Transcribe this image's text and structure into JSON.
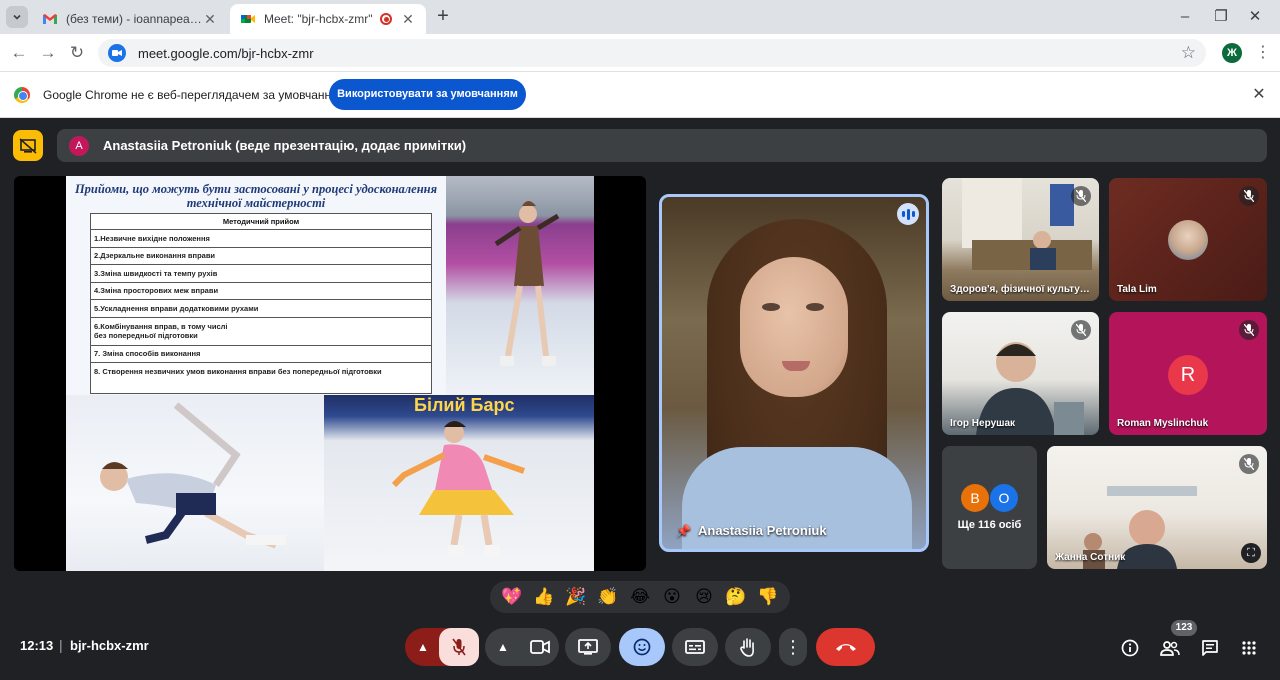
{
  "tabs": [
    {
      "title": "(без теми) - ioannapeace@gmail.com",
      "favicon": "gmail-icon",
      "active": false
    },
    {
      "title": "Meet: \"bjr-hcbx-zmr\"",
      "favicon": "meet-icon",
      "active": true,
      "recording": true
    }
  ],
  "address_bar": {
    "url": "meet.google.com/bjr-hcbx-zmr",
    "profile_letter": "Ж"
  },
  "infobar": {
    "message": "Google Chrome не є веб-переглядачем за умовчанням",
    "button": "Використовувати за умовчанням"
  },
  "presenter": {
    "avatar_letter": "A",
    "text": "Anastasiia Petroniuk (веде презентацію, додає примітки)"
  },
  "slide": {
    "title": "Прийоми, що можуть бути застосовані у процесі удосконалення технічної майстерності",
    "table_header": "Методичний прийом",
    "rows": [
      "1.Незвичне вихідне положення",
      "2.Дзеркальне виконання вправи",
      "3.Зміна швидкості та темпу рухів",
      "4.Зміна просторових меж вправи",
      "5.Ускладнення вправи додатковими рухами",
      "6.Комбінування вправ, в тому числі\nбез попередньої підготовки",
      "7. Зміна способів виконання",
      "8. Створення незвичних умов виконання вправи без попередньої підготовки"
    ],
    "banner": "Білий Барс"
  },
  "speaker": {
    "name": "Anastasiia Petroniuk"
  },
  "tiles": [
    {
      "name": "Здоров'я, фізичної культури"
    },
    {
      "name": "Tala Lim"
    },
    {
      "name": "Ігор Нерушак"
    },
    {
      "name": "Roman Myslinchuk",
      "avatar_letter": "R"
    },
    {
      "name": "Жанна Сотник"
    }
  ],
  "more": {
    "avatars": [
      "B",
      "O"
    ],
    "avatar_colors": [
      "#e8710a",
      "#1a73e8"
    ],
    "label": "Ще 116 осіб"
  },
  "reactions": [
    "💖",
    "👍",
    "🎉",
    "👏",
    "😂",
    "😮",
    "😢",
    "🤔",
    "👎"
  ],
  "bottom": {
    "time": "12:13",
    "separator": "|",
    "meeting_code": "bjr-hcbx-zmr",
    "participants_count": "123"
  },
  "colors": {
    "accent": "#a8c7fa",
    "end_call": "#dc362e",
    "presenting": "#fbbc04",
    "mic_off": "#8c1d18"
  }
}
